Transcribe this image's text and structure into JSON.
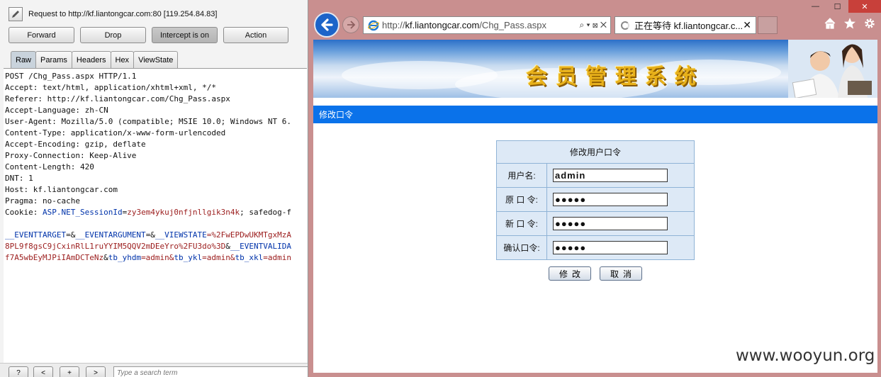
{
  "burp": {
    "request_title": "Request to http://kf.liantongcar.com:80  [119.254.84.83]",
    "buttons": {
      "forward": "Forward",
      "drop": "Drop",
      "intercept": "Intercept is on",
      "action": "Action"
    },
    "tabs": [
      "Raw",
      "Params",
      "Headers",
      "Hex",
      "ViewState"
    ],
    "active_tab": "Raw",
    "raw_lines": [
      "POST /Chg_Pass.aspx HTTP/1.1",
      "Accept: text/html, application/xhtml+xml, */*",
      "Referer: http://kf.liantongcar.com/Chg_Pass.aspx",
      "Accept-Language: zh-CN",
      "User-Agent: Mozilla/5.0 (compatible; MSIE 10.0; Windows NT 6.",
      "Content-Type: application/x-www-form-urlencoded",
      "Accept-Encoding: gzip, deflate",
      "Proxy-Connection: Keep-Alive",
      "Content-Length: 420",
      "DNT: 1",
      "Host: kf.liantongcar.com",
      "Pragma: no-cache"
    ],
    "cookie_label": "Cookie: ",
    "cookie_key": "ASP.NET_SessionId",
    "cookie_value": "zy3em4ykuj0nfjnllgik3n4k",
    "cookie_rest": "; safedog-f",
    "body_line1_a": "__EVENTTARGET",
    "body_line1_b": "=&",
    "body_line1_c": "__EVENTARGUMENT",
    "body_line1_d": "=&",
    "body_line1_e": "__VIEWSTATE",
    "body_line1_f": "=%2FwEPDwUKMTgxMzA",
    "body_line2_a": "8PL9f8gsC9jCxinRlL1ruYYIM5QQV2mDEeYro%2FU3do%3D",
    "body_line2_b": "&",
    "body_line2_c": "__EVENTVALIDA",
    "body_line3_a": "f7A5wbEyMJPiIAmDCTeNz",
    "body_line3_b": "&",
    "body_line3_c": "tb_yhdm",
    "body_line3_d": "=admin&",
    "body_line3_e": "tb_ykl",
    "body_line3_f": "=admin&",
    "body_line3_g": "tb_xkl",
    "body_line3_h": "=admin",
    "search_buttons": [
      "?",
      "<",
      "+",
      ">"
    ],
    "search_placeholder": "Type a search term"
  },
  "browser": {
    "url": "http://kf.liantongcar.com/Chg_Pass.aspx",
    "url_host": "kf.liantongcar.com",
    "url_prefix": "http://",
    "url_path": "/Chg_Pass.aspx",
    "address_controls": "⌕ ▾ ⊠ ✕",
    "tab_title": "正在等待 kf.liantongcar.c...",
    "tab_close": "✕",
    "window_controls": [
      "—",
      "☐",
      "✕"
    ],
    "toolbar_icons": [
      "home-icon",
      "star-icon",
      "gear-icon"
    ]
  },
  "page": {
    "banner_title": "会员管理系统",
    "menu_title": "修改口令",
    "form_header": "修改用户口令",
    "fields": [
      {
        "label": "用户名:",
        "value": "admin"
      },
      {
        "label": "原 口 令:",
        "value": "●●●●●"
      },
      {
        "label": "新 口 令:",
        "value": "●●●●●"
      },
      {
        "label": "确认口令:",
        "value": "●●●●●"
      }
    ],
    "submit_label": "修改",
    "cancel_label": "取消"
  },
  "watermark": "www.wooyun.org",
  "colors": {
    "accent": "#0a72ea",
    "form_bg": "#dde9f6",
    "browser_frame": "#c98f8f",
    "banner_text": "#e8b11a"
  }
}
